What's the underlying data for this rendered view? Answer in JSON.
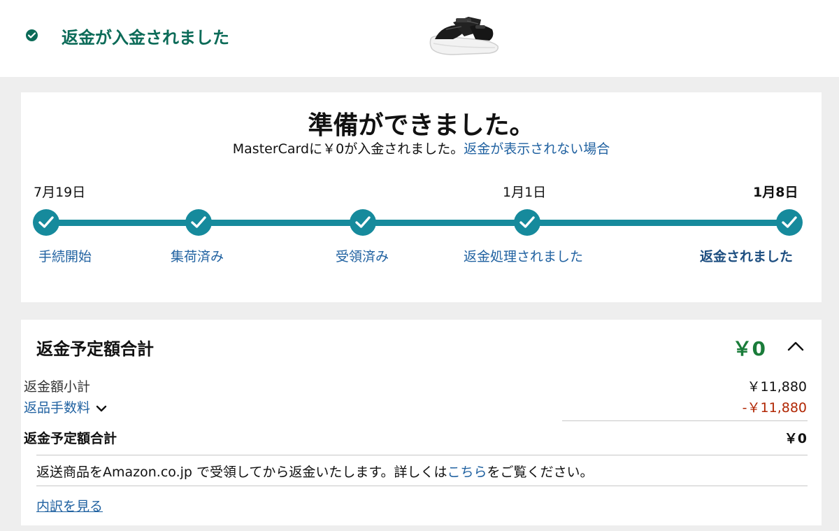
{
  "status": {
    "text": "返金が入金されました",
    "color": "#0c6b58"
  },
  "product": {
    "image_icon": "sandal-image"
  },
  "progress": {
    "headline": "準備ができました。",
    "message": "MasterCardに￥0が入金されました。",
    "help_link": "返金が表示されない場合",
    "dates": {
      "start": "7月19日",
      "processed": "1月1日",
      "refunded": "1月8日"
    },
    "steps": [
      {
        "label": "手続開始",
        "done": true
      },
      {
        "label": "集荷済み",
        "done": true
      },
      {
        "label": "受領済み",
        "done": true
      },
      {
        "label": "返金処理されました",
        "done": true
      },
      {
        "label": "返金されました",
        "done": true,
        "current": true
      }
    ],
    "track_color": "#168a9c"
  },
  "refund": {
    "title": "返金予定額合計",
    "amount": "￥0",
    "amount_color": "#1a7c3a",
    "rows": {
      "subtotal_label": "返金額小計",
      "subtotal_value": "￥11,880",
      "fee_label": "返品手数料",
      "fee_value": "-￥11,880",
      "fee_color": "#b12704",
      "total_label": "返金予定額合計",
      "total_value": "￥0"
    },
    "note_prefix": "返送商品をAmazon.co.jp で受領してから返金いたします。詳しくは",
    "note_link": "こちら",
    "note_suffix": "をご覧ください。",
    "details_link": "内訳を見る"
  }
}
